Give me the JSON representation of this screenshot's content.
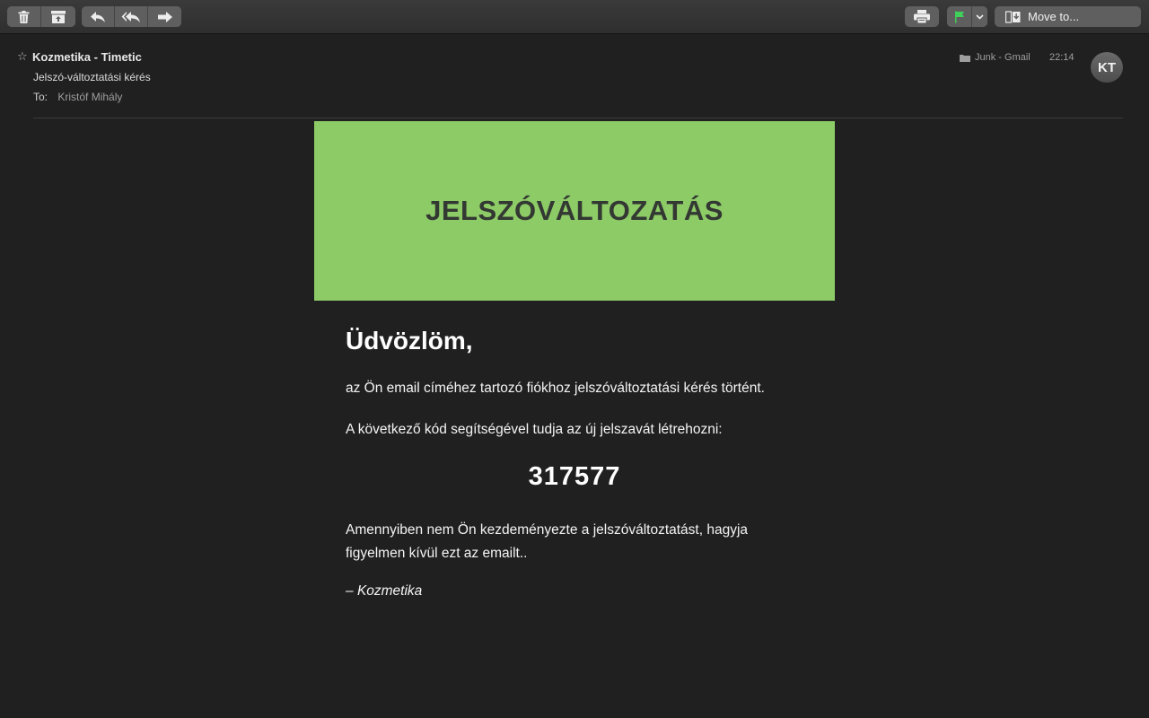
{
  "toolbar": {
    "buttons": [
      {
        "name": "delete",
        "icon": "trash-icon"
      },
      {
        "name": "archive",
        "icon": "archive-icon"
      },
      {
        "name": "reply",
        "icon": "reply-icon"
      },
      {
        "name": "reply-all",
        "icon": "reply-all-icon"
      },
      {
        "name": "forward",
        "icon": "forward-icon"
      },
      {
        "name": "print",
        "icon": "print-icon"
      },
      {
        "name": "flag",
        "icon": "flag-icon",
        "color": "#3fd15a"
      },
      {
        "name": "flag-menu",
        "icon": "chevron-down-icon"
      }
    ],
    "move_to_label": "Move to..."
  },
  "message": {
    "starred": false,
    "sender": "Kozmetika - Timetic",
    "subject": "Jelszó-változtatási kérés",
    "to_label": "To:",
    "to_name": "Kristóf Mihály",
    "folder": "Junk - Gmail",
    "time": "22:14",
    "avatar_initials": "KT"
  },
  "email": {
    "banner_color": "#8dcb67",
    "banner_title": "JELSZÓVÁLTOZATÁS",
    "greeting": "Üdvözlöm,",
    "paragraph1": "az Ön email címéhez tartozó fiókhoz jelszóváltoztatási kérés történt.",
    "paragraph2": "A következő kód segítségével tudja az új jelszavát létrehozni:",
    "code": "317577",
    "paragraph3": "Amennyiben nem Ön kezdeményezte a jelszóváltoztatást, hagyja figyelmen kívül ezt az emailt..",
    "signature_dash": "– ",
    "signature_name": "Kozmetika"
  }
}
